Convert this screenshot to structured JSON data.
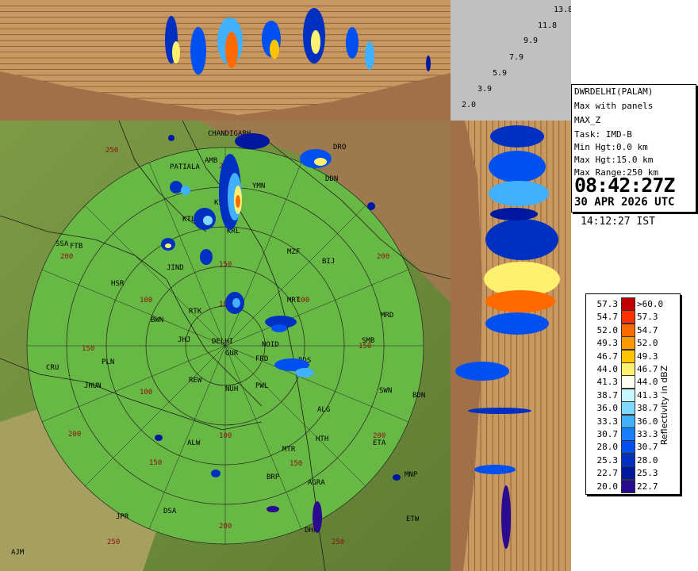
{
  "station": {
    "name": "DWRDELHI(PALAM)",
    "product": "Max with panels",
    "variable": "MAX_Z",
    "task": "Task: IMD-B",
    "min_hgt": "Min Hgt:0.0 km",
    "max_hgt": "Max Hgt:15.0 km",
    "max_range": "Max Range:250 km",
    "time_utc": "08:42:27Z",
    "date_utc": "30 APR 2026 UTC",
    "time_ist": "14:12:27 IST"
  },
  "height_labels": [
    "13.8",
    "11.8",
    "9.9",
    "7.9",
    "5.9",
    "3.9",
    "2.0"
  ],
  "legend": {
    "caption": "Reflectivity in dBZ",
    "rows": [
      {
        "lo": "57.3",
        "hi": ">60.0",
        "color": "#c00000"
      },
      {
        "lo": "54.7",
        "hi": "57.3",
        "color": "#ff3000"
      },
      {
        "lo": "52.0",
        "hi": "54.7",
        "color": "#ff6a00"
      },
      {
        "lo": "49.3",
        "hi": "52.0",
        "color": "#ff9a00"
      },
      {
        "lo": "46.7",
        "hi": "49.3",
        "color": "#ffc400"
      },
      {
        "lo": "44.0",
        "hi": "46.7",
        "color": "#fff070"
      },
      {
        "lo": "41.3",
        "hi": "44.0",
        "color": "#fffff0"
      },
      {
        "lo": "38.7",
        "hi": "41.3",
        "color": "#c8f8ff"
      },
      {
        "lo": "36.0",
        "hi": "38.7",
        "color": "#80d8ff"
      },
      {
        "lo": "33.3",
        "hi": "36.0",
        "color": "#40b0ff"
      },
      {
        "lo": "30.7",
        "hi": "33.3",
        "color": "#1880ff"
      },
      {
        "lo": "28.0",
        "hi": "30.7",
        "color": "#0050f0"
      },
      {
        "lo": "25.3",
        "hi": "28.0",
        "color": "#0030c0"
      },
      {
        "lo": "22.7",
        "hi": "25.3",
        "color": "#0018a0"
      },
      {
        "lo": "20.0",
        "hi": "22.7",
        "color": "#2a0a90"
      }
    ]
  },
  "range_labels": [
    "100",
    "150",
    "200",
    "250"
  ],
  "places": [
    "CHANDIGARH",
    "PATIALA",
    "AMB",
    "DDN",
    "YMN",
    "KSH",
    "KTL",
    "KRL",
    "SSA",
    "FTB",
    "MZF",
    "BIJ",
    "JIND",
    "HSR",
    "RTK",
    "BWN",
    "MRT",
    "MRD",
    "JHJ",
    "DELHI",
    "NOID",
    "SMB",
    "GUR",
    "FRD",
    "BDS",
    "CRU",
    "PLN",
    "JHUN",
    "REW",
    "NUH",
    "PWL",
    "SWN",
    "BDN",
    "ALG",
    "HTH",
    "ETA",
    "ALW",
    "MTR",
    "BRP",
    "AGRA",
    "MNP",
    "JPR",
    "DSA",
    "DHP",
    "ETW",
    "AJM",
    "DRO"
  ]
}
